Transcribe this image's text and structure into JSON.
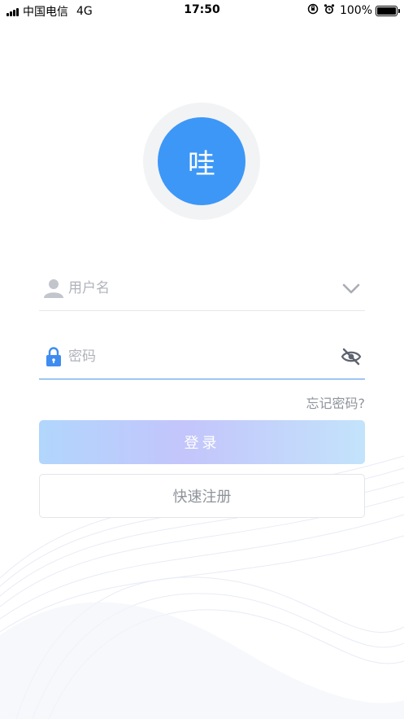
{
  "status_bar": {
    "carrier": "中国电信",
    "network": "4G",
    "time": "17:50",
    "battery": "100%",
    "icons": [
      "signal-icon",
      "orientation-lock-icon",
      "alarm-icon",
      "battery-icon"
    ]
  },
  "logo": {
    "text": "哇",
    "color": "#3d97f7"
  },
  "login_form": {
    "username": {
      "placeholder": "用户名",
      "value": "",
      "icon": "user-icon",
      "right_icon": "chevron-down-icon"
    },
    "password": {
      "placeholder": "密码",
      "value": "",
      "icon": "lock-icon",
      "right_icon": "eye-off-icon"
    },
    "forgot_password": "忘记密码?",
    "login_button": "登录",
    "register_button": "快速注册"
  },
  "colors": {
    "accent": "#3d97f7",
    "lock_icon": "#3f8cf0",
    "placeholder": "#b0b3ba",
    "muted_text": "#8f949c"
  }
}
